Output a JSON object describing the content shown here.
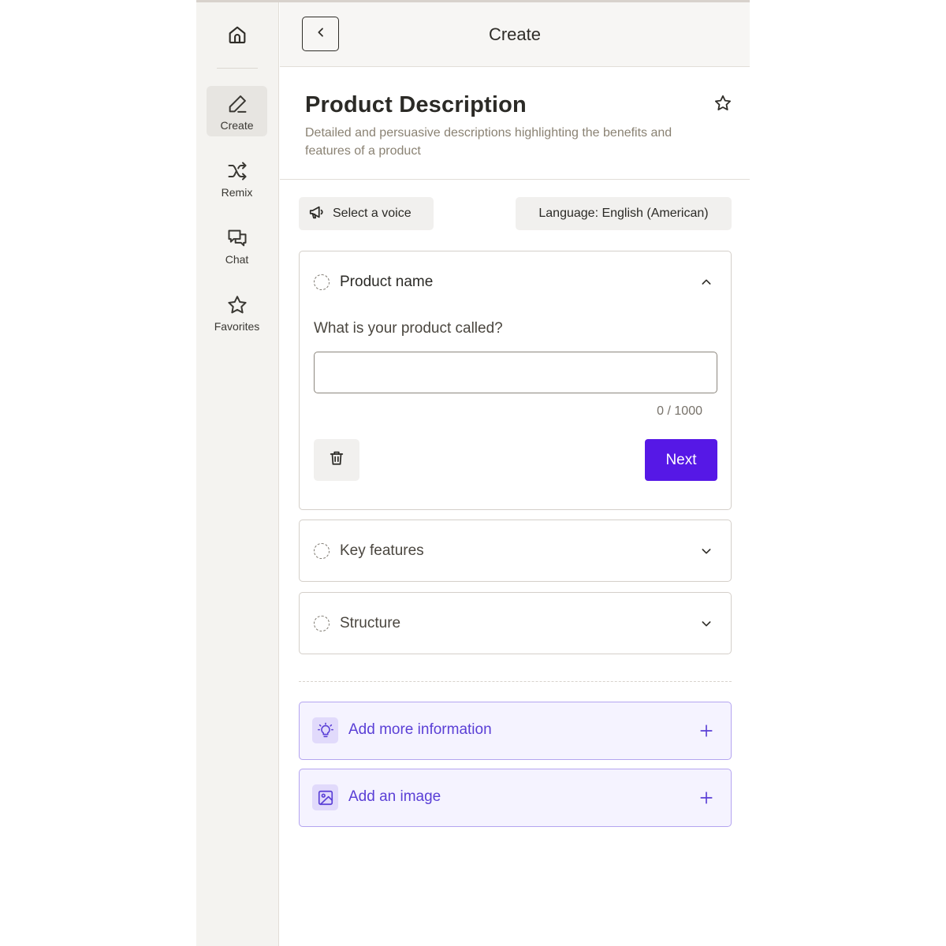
{
  "sidebar": {
    "home_icon": "home-icon",
    "items": [
      {
        "label": "Create",
        "icon": "pen-icon",
        "active": true
      },
      {
        "label": "Remix",
        "icon": "shuffle-icon",
        "active": false
      },
      {
        "label": "Chat",
        "icon": "chat-bubbles-icon",
        "active": false
      },
      {
        "label": "Favorites",
        "icon": "star-icon",
        "active": false
      }
    ]
  },
  "topbar": {
    "title": "Create",
    "back_icon": "chevron-left-icon"
  },
  "header": {
    "title": "Product Description",
    "description": "Detailed and persuasive descriptions highlighting the benefits and features of a product",
    "favorite_icon": "star-icon"
  },
  "controls": {
    "voice_label": "Select a voice",
    "voice_icon": "megaphone-icon",
    "language_label": "Language: English (American)"
  },
  "sections": [
    {
      "title": "Product name",
      "expanded": true,
      "question": "What is your product called?",
      "input_value": "",
      "counter": "0 / 1000",
      "next_label": "Next"
    },
    {
      "title": "Key features",
      "expanded": false
    },
    {
      "title": "Structure",
      "expanded": false
    }
  ],
  "add_cards": [
    {
      "label": "Add more information",
      "icon": "lightbulb-icon"
    },
    {
      "label": "Add an image",
      "icon": "image-icon"
    }
  ],
  "colors": {
    "accent": "#5618e6",
    "accent_text": "#5a3fd6",
    "accent_bg": "#f5f3ff",
    "accent_border": "#b4a4f0",
    "sidebar_bg": "#f4f3f0",
    "muted_text": "#8a8273"
  }
}
